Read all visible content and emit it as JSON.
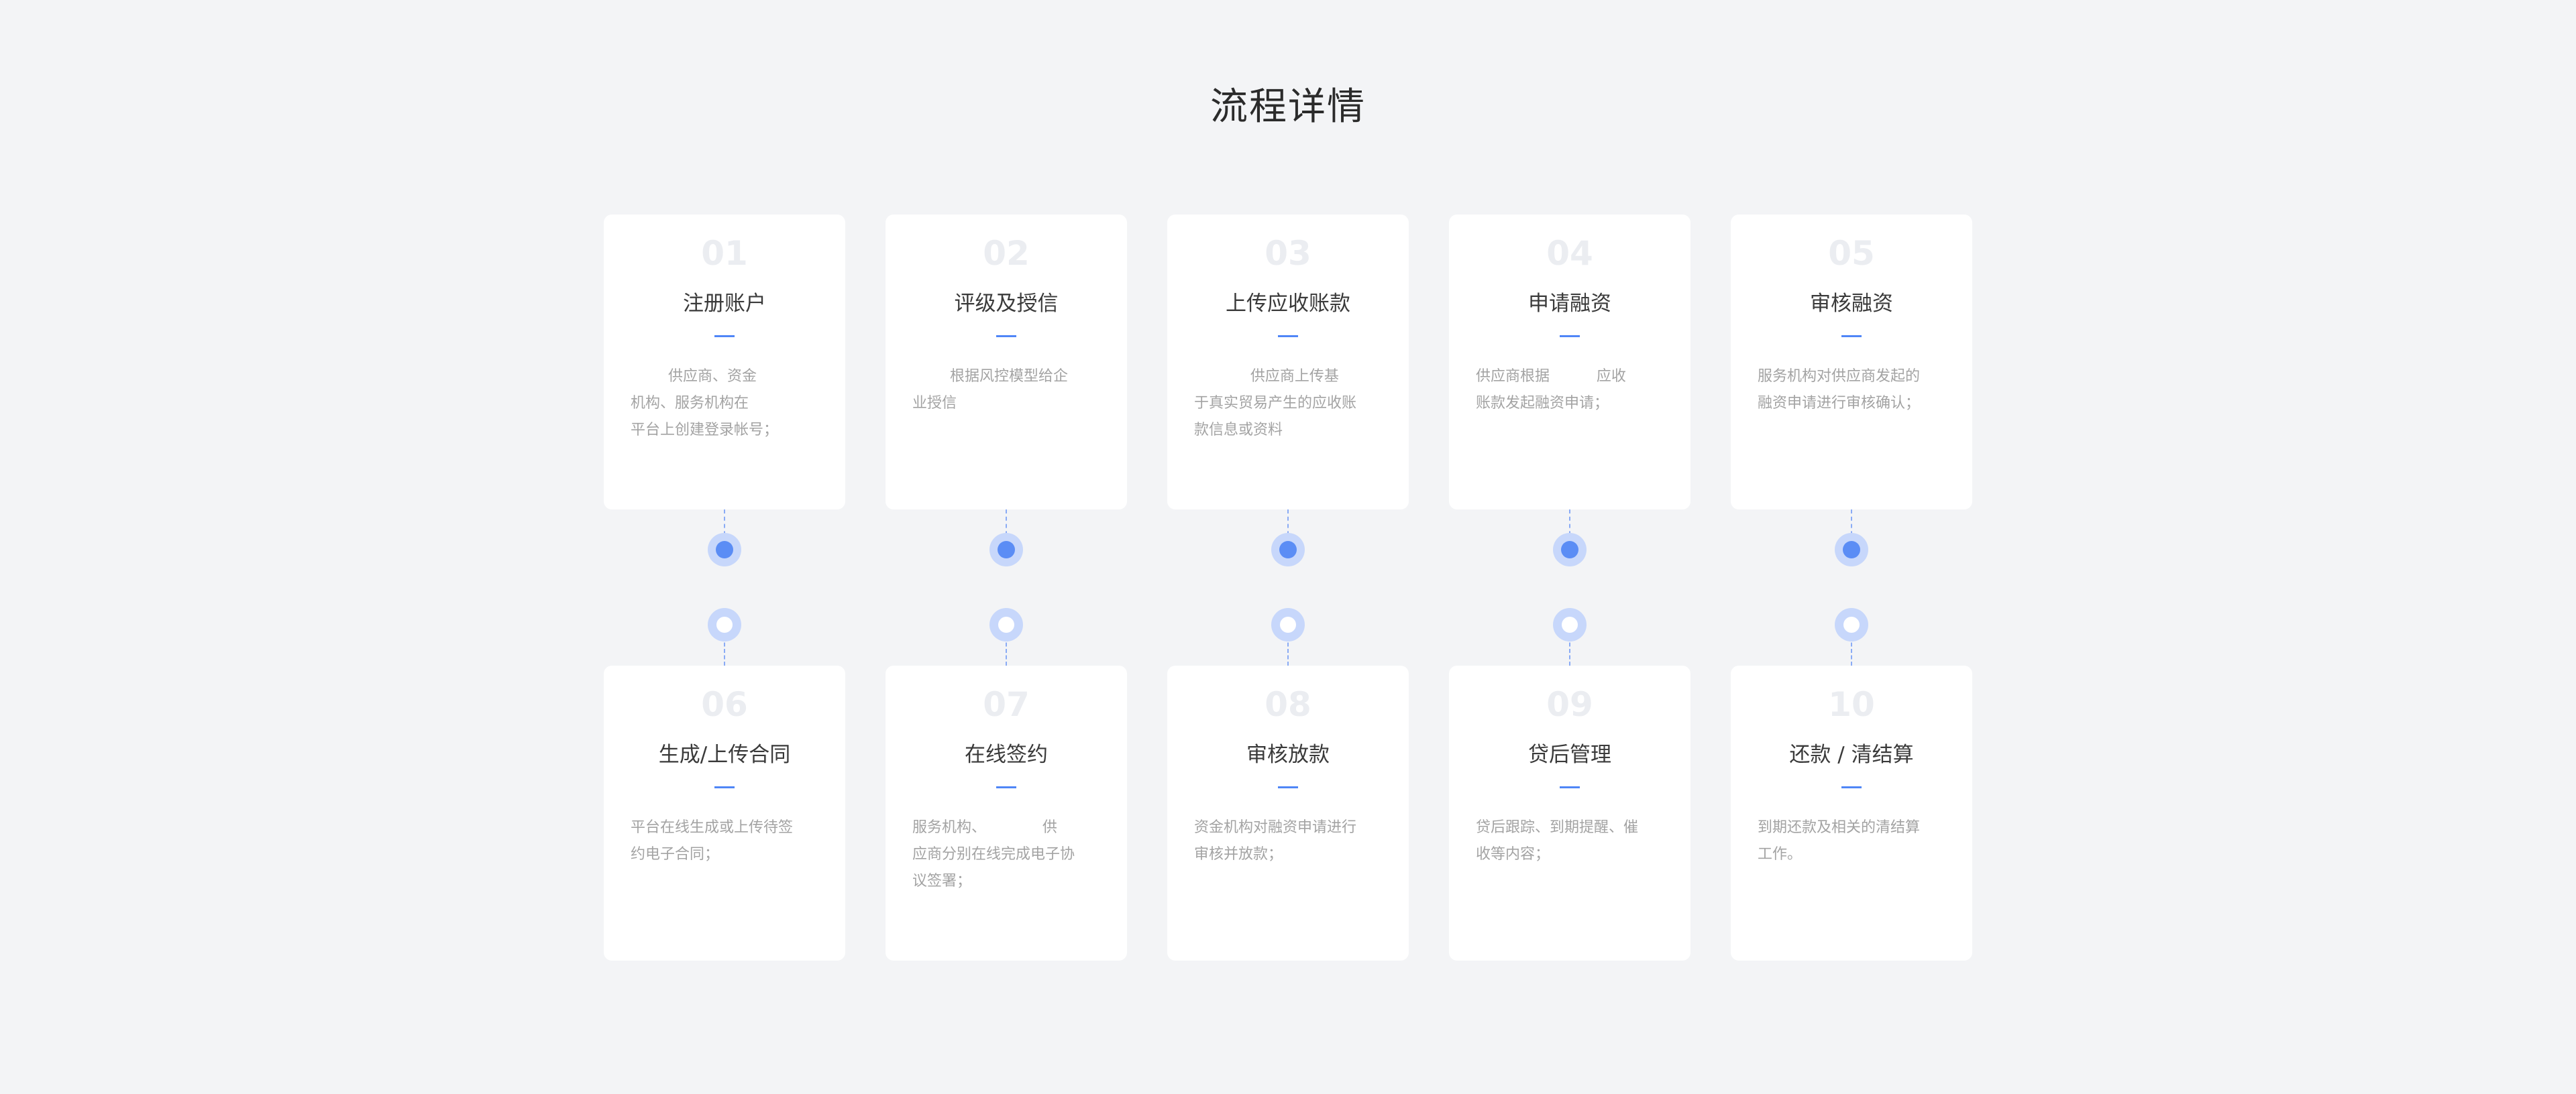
{
  "title": "流程详情",
  "accent_color": "#4f86f7",
  "steps": [
    {
      "num": "01",
      "title": "注册账户",
      "desc": "        供应商、资金\n机构、服务机构在\n平台上创建登录帐号；"
    },
    {
      "num": "02",
      "title": "评级及授信",
      "desc": "        根据风控模型给企\n业授信"
    },
    {
      "num": "03",
      "title": "上传应收账款",
      "desc": "            供应商上传基\n于真实贸易产生的应收账\n款信息或资料"
    },
    {
      "num": "04",
      "title": "申请融资",
      "desc": "供应商根据          应收\n账款发起融资申请；"
    },
    {
      "num": "05",
      "title": "审核融资",
      "desc": "服务机构对供应商发起的\n融资申请进行审核确认；"
    },
    {
      "num": "06",
      "title": "生成/上传合同",
      "desc": "平台在线生成或上传待签\n约电子合同；"
    },
    {
      "num": "07",
      "title": "在线签约",
      "desc": "服务机构、            供\n应商分别在线完成电子协\n议签署；"
    },
    {
      "num": "08",
      "title": "审核放款",
      "desc": "资金机构对融资申请进行\n审核并放款；"
    },
    {
      "num": "09",
      "title": "贷后管理",
      "desc": "贷后跟踪、到期提醒、催\n收等内容；"
    },
    {
      "num": "10",
      "title": "还款 / 清结算",
      "desc": "到期还款及相关的清结算\n工作。"
    }
  ]
}
